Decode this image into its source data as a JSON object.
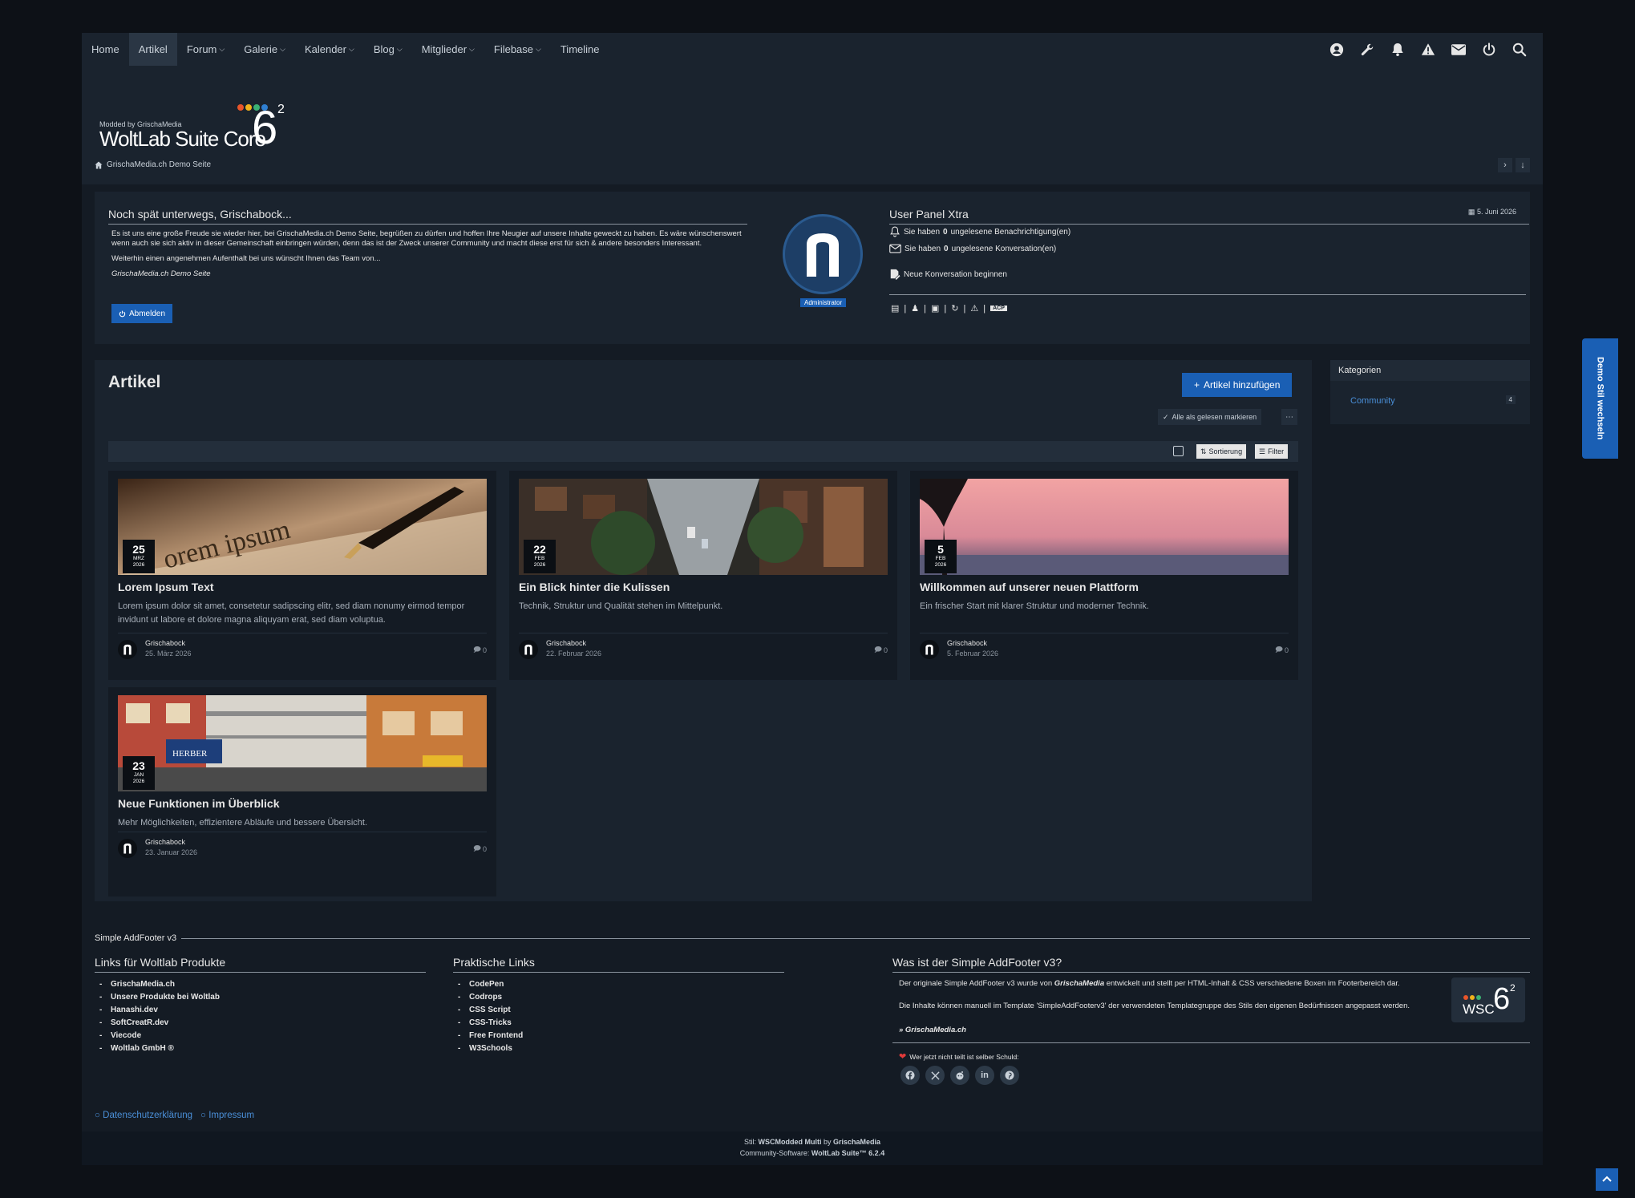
{
  "nav": {
    "items": [
      {
        "label": "Home",
        "caret": false
      },
      {
        "label": "Artikel",
        "caret": false,
        "active": true
      },
      {
        "label": "Forum",
        "caret": true
      },
      {
        "label": "Galerie",
        "caret": true
      },
      {
        "label": "Kalender",
        "caret": true
      },
      {
        "label": "Blog",
        "caret": true
      },
      {
        "label": "Mitglieder",
        "caret": true
      },
      {
        "label": "Filebase",
        "caret": true
      },
      {
        "label": "Timeline",
        "caret": false
      }
    ]
  },
  "logo": {
    "small": "Modded by GrischaMedia",
    "big": "WoltLab Suite Core",
    "version": "6",
    "sup": "2"
  },
  "breadcrumb": "GrischaMedia.ch Demo Seite",
  "welcome": {
    "title": "Noch spät unterwegs, Grischabock...",
    "p1": "Es ist uns eine große Freude sie wieder hier, bei GrischaMedia.ch Demo Seite, begrüßen zu dürfen und hoffen Ihre Neugier auf unsere Inhalte geweckt zu haben. Es wäre wünschenswert wenn auch sie sich aktiv in dieser Gemeinschaft einbringen würden, denn das ist der Zweck unserer Community und macht diese erst für sich & andere besonders Interessant.",
    "p2": "Weiterhin einen angenehmen Aufenthalt bei uns wünscht Ihnen das Team von...",
    "p3": "GrischaMedia.ch Demo Seite",
    "logout": "Abmelden"
  },
  "userpanel": {
    "badge": "Administrator",
    "title": "User Panel Xtra",
    "date": "5. Juni 2026",
    "notif_pre": "Sie haben",
    "notif_count": "0",
    "notif_post": "ungelesene Benachrichtigung(en)",
    "conv_pre": "Sie haben",
    "conv_count": "0",
    "conv_post": "ungelesene Konversation(en)",
    "new_conv": "Neue Konversation beginnen",
    "acp": "ACP"
  },
  "articles": {
    "title": "Artikel",
    "add_button": "Artikel hinzufügen",
    "mark_read": "Alle als gelesen markieren",
    "sort_label": "Sortierung",
    "filter_label": "Filter",
    "items": [
      {
        "day": "25",
        "month": "MRZ",
        "year": "2026",
        "title": "Lorem Ipsum Text",
        "text": "Lorem ipsum dolor sit amet, consetetur sadipscing elitr, sed diam nonumy eirmod tempor invidunt ut labore et dolore magna aliquyam erat, sed diam voluptua.",
        "author": "Grischabock",
        "date": "25. März 2026",
        "comments": "0"
      },
      {
        "day": "22",
        "month": "FEB",
        "year": "2026",
        "title": "Ein Blick hinter die Kulissen",
        "text": "Technik, Struktur und Qualität stehen im Mittelpunkt.",
        "author": "Grischabock",
        "date": "22. Februar 2026",
        "comments": "0"
      },
      {
        "day": "5",
        "month": "FEB",
        "year": "2026",
        "title": "Willkommen auf unserer neuen Plattform",
        "text": "Ein frischer Start mit klarer Struktur und moderner Technik.",
        "author": "Grischabock",
        "date": "5. Februar 2026",
        "comments": "0"
      },
      {
        "day": "23",
        "month": "JAN",
        "year": "2026",
        "title": "Neue Funktionen im Überblick",
        "text": "Mehr Möglichkeiten, effizientere Abläufe und bessere Übersicht.",
        "author": "Grischabock",
        "date": "23. Januar 2026",
        "comments": "0"
      }
    ]
  },
  "sidebar": {
    "title": "Kategorien",
    "item": "Community",
    "count": "4"
  },
  "style_switch": "Demo Stil wechseln",
  "footer": {
    "bar_title": "Simple AddFooter v3",
    "col1": {
      "title": "Links für Woltlab Produkte",
      "links": [
        "GrischaMedia.ch",
        "Unsere Produkte bei Woltlab",
        "Hanashi.dev",
        "SoftCreatR.dev",
        "Viecode",
        "Woltlab GmbH ®"
      ]
    },
    "col2": {
      "title": "Praktische Links",
      "links": [
        "CodePen",
        "Codrops",
        "CSS Script",
        "CSS-Tricks",
        "Free Frontend",
        "W3Schools"
      ]
    },
    "col3": {
      "title": "Was ist der Simple AddFooter v3?",
      "line1_pre": "Der originale Simple AddFooter v3 wurde von",
      "line1_link": "GrischaMedia",
      "line1_post": "entwickelt und stellt per HTML-Inhalt & CSS verschiedene Boxen im Footerbereich dar.",
      "line2": "Die Inhalte können manuell im Template 'SimpleAddFooterv3' der verwendeten Templategruppe des Stils den eigenen Bedürfnissen angepasst werden.",
      "line3": "» GrischaMedia.ch",
      "wsc_text": "WSC",
      "wsc_version": "6",
      "wsc_sup": "2",
      "share": "Wer jetzt nicht teilt ist selber Schuld:"
    },
    "legal": [
      "Datenschutzerklärung",
      "Impressum"
    ],
    "copy1_pre": "Stil:",
    "copy1_style": "WSCModded Multi",
    "copy1_by": "by",
    "copy1_author": "GrischaMedia",
    "copy2_pre": "Community-Software:",
    "copy2_sw": "WoltLab Suite™ 6.2.4"
  }
}
